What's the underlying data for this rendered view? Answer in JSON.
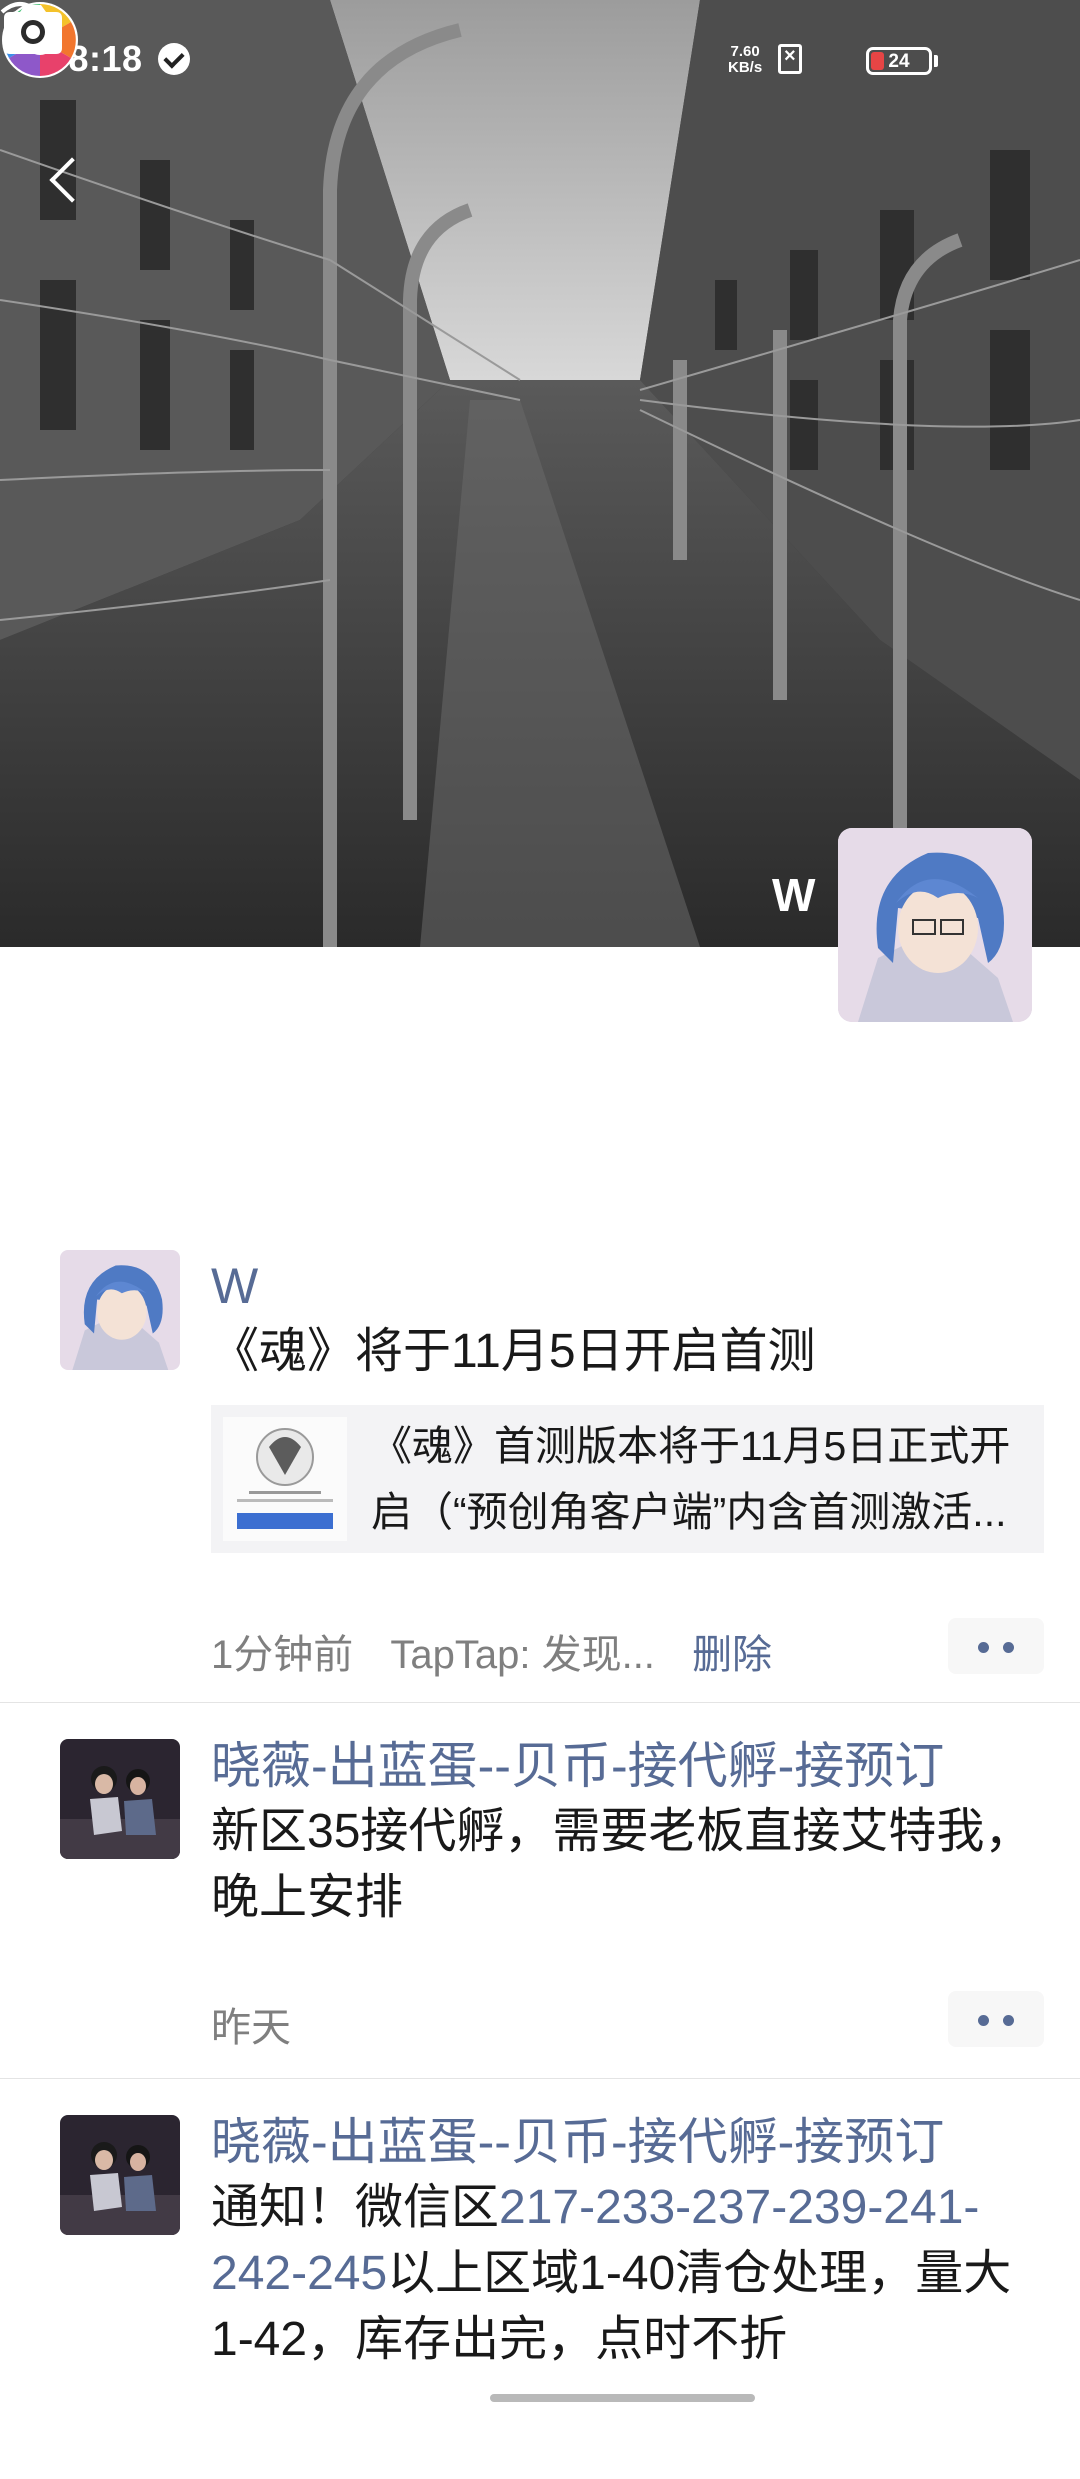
{
  "status_bar": {
    "time": "08:18",
    "net_speed_value": "7.60",
    "net_speed_unit": "KB/s",
    "battery_level": "24",
    "battery_fraction": 0.24
  },
  "header": {
    "back_icon": "back-chevron-icon",
    "camera_icon": "camera-icon"
  },
  "profile": {
    "nickname": "W"
  },
  "posts": [
    {
      "author": "W",
      "text": "《魂》将于11月5日开启首测",
      "share_text": "《魂》首测版本将于11月5日正式开启（“预创角客户端”内含首测激活...",
      "time": "1分钟前",
      "source": "TapTap: 发现...",
      "delete_label": "删除"
    },
    {
      "author": "晓薇-出蓝蛋--贝币-接代孵-接预订",
      "text": "新区35接代孵，需要老板直接艾特我，晚上安排",
      "time": "昨天"
    },
    {
      "author": "晓薇-出蓝蛋--贝币-接代孵-接预订",
      "text_prefix": "通知！微信区",
      "text_link": "217-233-237-239-241-242-245",
      "text_suffix": "以上区域1-40清仓处理，量大1-42，库存出完，点时不折"
    }
  ]
}
